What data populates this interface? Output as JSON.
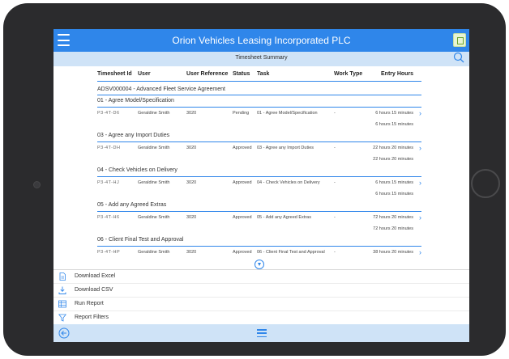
{
  "app": {
    "title": "Orion Vehicles Leasing Incorporated PLC"
  },
  "subbar": {
    "title": "Timesheet Summary"
  },
  "table": {
    "headers": [
      "Timesheet Id",
      "User",
      "User Reference",
      "Status",
      "Task",
      "Work Type",
      "Entry Hours"
    ],
    "section_label": "ADSV000004 - Advanced Fleet Service Agreement",
    "groups": [
      {
        "label": "01 - Agree Model/Specification",
        "row": {
          "id": "P3-4T-D6",
          "user": "Geraldine Smith",
          "ref": "3020",
          "status": "Pending",
          "task": "01 - Agree Model/Specification",
          "work": "-",
          "hours": "6 hours 15 minutes"
        },
        "total": "6 hours 15 minutes"
      },
      {
        "label": "03 - Agree any Import Duties",
        "row": {
          "id": "P3-4T-DH",
          "user": "Geraldine Smith",
          "ref": "3020",
          "status": "Approved",
          "task": "03 - Agree any Import Duties",
          "work": "-",
          "hours": "22 hours 20 minutes"
        },
        "total": "22 hours 20 minutes"
      },
      {
        "label": "04 - Check Vehicles on Delivery",
        "row": {
          "id": "P3-4T-HJ",
          "user": "Geraldine Smith",
          "ref": "3020",
          "status": "Approved",
          "task": "04 - Check Vehicles on Delivery",
          "work": "-",
          "hours": "6 hours 15 minutes"
        },
        "total": "6 hours 15 minutes"
      },
      {
        "label": "05 - Add any Agreed Extras",
        "row": {
          "id": "P3-4T-H6",
          "user": "Geraldine Smith",
          "ref": "3020",
          "status": "Approved",
          "task": "05 - Add any Agreed Extras",
          "work": "-",
          "hours": "72 hours 20 minutes"
        },
        "total": "72 hours 20 minutes"
      },
      {
        "label": "06 - Client Final Test and Approval",
        "row": {
          "id": "P3-4T-HP",
          "user": "Geraldine Smith",
          "ref": "3020",
          "status": "Approved",
          "task": "06 - Client Final Test and Approval",
          "work": "-",
          "hours": "38 hours 20 minutes"
        },
        "total": ""
      }
    ]
  },
  "actions": {
    "items": [
      {
        "label": "Download Excel",
        "icon": "excel-file-icon"
      },
      {
        "label": "Download CSV",
        "icon": "csv-file-icon"
      },
      {
        "label": "Run Report",
        "icon": "table-icon"
      },
      {
        "label": "Report Filters",
        "icon": "filter-icon"
      }
    ]
  },
  "colors": {
    "accent": "#2f86ea",
    "subbar": "#cfe3f7",
    "device": "#2b2b2d"
  }
}
